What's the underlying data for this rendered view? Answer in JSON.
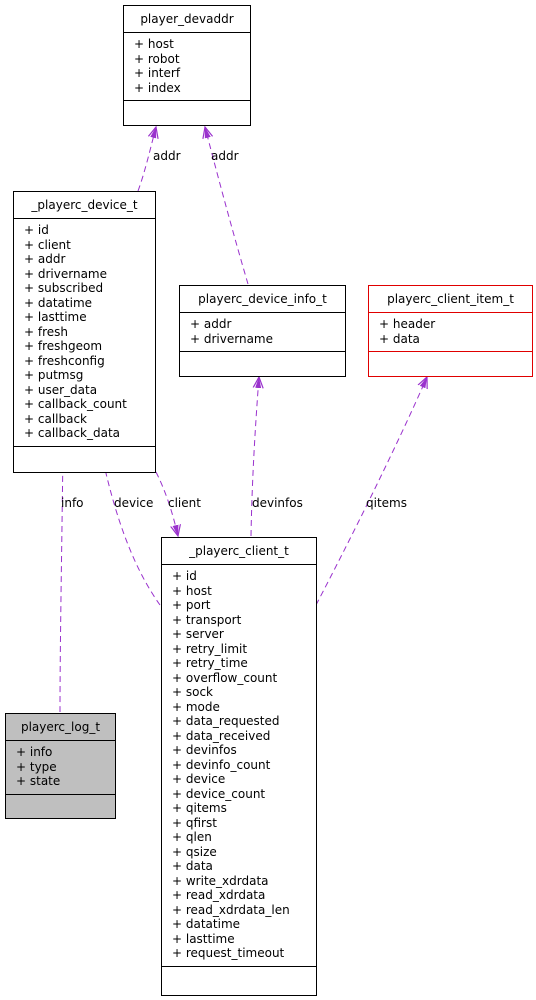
{
  "diagram": {
    "classes": {
      "player_devaddr": {
        "name": "player_devaddr",
        "attributes": [
          "+ host",
          "+ robot",
          "+ interf",
          "+ index"
        ]
      },
      "playerc_device_t": {
        "name": "_playerc_device_t",
        "attributes": [
          "+ id",
          "+ client",
          "+ addr",
          "+ drivername",
          "+ subscribed",
          "+ datatime",
          "+ lasttime",
          "+ fresh",
          "+ freshgeom",
          "+ freshconfig",
          "+ putmsg",
          "+ user_data",
          "+ callback_count",
          "+ callback",
          "+ callback_data"
        ]
      },
      "playerc_device_info_t": {
        "name": "playerc_device_info_t",
        "attributes": [
          "+ addr",
          "+ drivername"
        ]
      },
      "playerc_client_item_t": {
        "name": "playerc_client_item_t",
        "attributes": [
          "+ header",
          "+ data"
        ]
      },
      "playerc_client_t": {
        "name": "_playerc_client_t",
        "attributes": [
          "+ id",
          "+ host",
          "+ port",
          "+ transport",
          "+ server",
          "+ retry_limit",
          "+ retry_time",
          "+ overflow_count",
          "+ sock",
          "+ mode",
          "+ data_requested",
          "+ data_received",
          "+ devinfos",
          "+ devinfo_count",
          "+ device",
          "+ device_count",
          "+ qitems",
          "+ qfirst",
          "+ qlen",
          "+ qsize",
          "+ data",
          "+ write_xdrdata",
          "+ read_xdrdata",
          "+ read_xdrdata_len",
          "+ datatime",
          "+ lasttime",
          "+ request_timeout"
        ]
      },
      "playerc_log_t": {
        "name": "playerc_log_t",
        "attributes": [
          "+ info",
          "+ type",
          "+ state"
        ]
      }
    },
    "edges": [
      {
        "from": "playerc_device_t",
        "to": "player_devaddr",
        "label": "addr"
      },
      {
        "from": "playerc_device_info_t",
        "to": "player_devaddr",
        "label": "addr"
      },
      {
        "from": "playerc_log_t",
        "to": "playerc_device_t",
        "label": "info"
      },
      {
        "from": "playerc_client_t",
        "to": "playerc_device_t",
        "label": "device"
      },
      {
        "from": "playerc_device_t",
        "to": "playerc_client_t",
        "label": "client"
      },
      {
        "from": "playerc_client_t",
        "to": "playerc_device_info_t",
        "label": "devinfos"
      },
      {
        "from": "playerc_client_t",
        "to": "playerc_client_item_t",
        "label": "qitems"
      }
    ],
    "colors": {
      "edge": "#9a32cd",
      "border": "#000000",
      "highlight_border": "#e00000",
      "highlight_fill": "#bfbfbf"
    }
  }
}
